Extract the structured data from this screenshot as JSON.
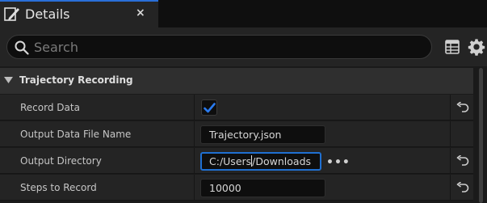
{
  "tab": {
    "title": "Details",
    "close": "×",
    "icon": "pencil-icon"
  },
  "search": {
    "placeholder": "Search",
    "value": ""
  },
  "toolbar": {
    "table_icon": "table-icon",
    "settings_icon": "gear-icon"
  },
  "section": {
    "title": "Trajectory Recording",
    "expanded": true
  },
  "rows": [
    {
      "label": "Record Data",
      "type": "checkbox",
      "checked": true,
      "resettable": true
    },
    {
      "label": "Output Data File Name",
      "type": "text",
      "value": "Trajectory.json",
      "resettable": false
    },
    {
      "label": "Output Directory",
      "type": "text",
      "value_before_caret": "C:/Users",
      "value_after_caret": "/Downloads",
      "focused": true,
      "browse": "•••",
      "resettable": true
    },
    {
      "label": "Steps to Record",
      "type": "number",
      "value": "10000",
      "resettable": true
    }
  ],
  "colors": {
    "accent": "#1f6fd1",
    "checkmark": "#2a7bef",
    "panel_bg": "#242424",
    "header_bg": "#2f2f2f"
  }
}
